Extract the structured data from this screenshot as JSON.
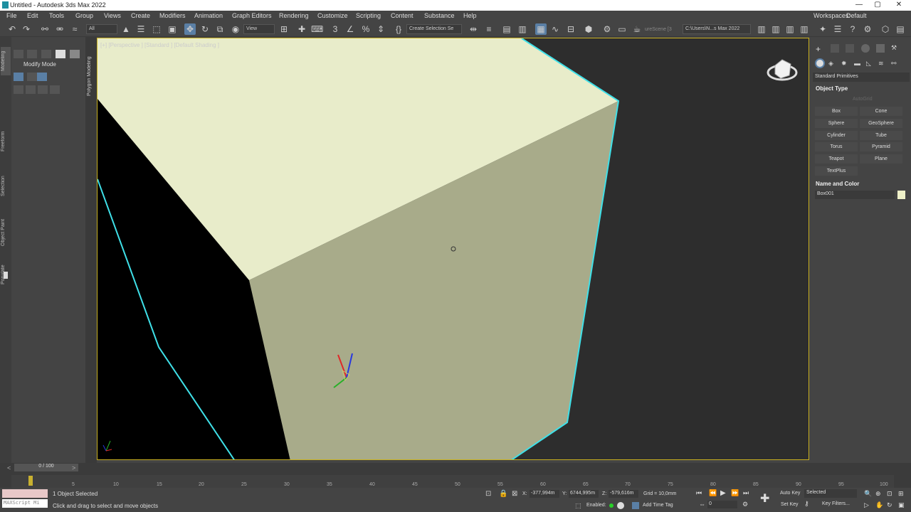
{
  "title": "Untitled - Autodesk 3ds Max 2022",
  "window": {
    "min": "—",
    "max": "▢",
    "close": "✕"
  },
  "menu": [
    {
      "label": "File"
    },
    {
      "label": "Edit"
    },
    {
      "label": "Tools"
    },
    {
      "label": "Group"
    },
    {
      "label": "Views"
    },
    {
      "label": "Create"
    },
    {
      "label": "Modifiers"
    },
    {
      "label": "Animation"
    },
    {
      "label": "Graph Editors"
    },
    {
      "label": "Rendering"
    },
    {
      "label": "Customize"
    },
    {
      "label": "Scripting"
    },
    {
      "label": "Content"
    },
    {
      "label": "Substance"
    },
    {
      "label": "Help"
    }
  ],
  "workspaces": {
    "label": "Workspaces:",
    "value": "Default"
  },
  "toolbar": {
    "filter": "All",
    "ref_coord": "View",
    "selection_set": "Create Selection Se",
    "scene_name": "ureScene [3",
    "path": "C:\\Users\\N...s Max 2022"
  },
  "left_tabs": [
    "Modeling",
    "Freeform",
    "Selection",
    "Object Paint",
    "Populate"
  ],
  "ribbon": {
    "mode": "Modify Mode",
    "side_tab": "Polygon Modeling"
  },
  "viewport": {
    "label": "[+] [Perspective ] [Standard ] [Default Shading ]",
    "colors": {
      "box_top": "#e8ecca",
      "box_front": "#a8ab8a",
      "bg": "#2d2d2d",
      "wire": "#3fe0e8"
    }
  },
  "cmd_panel": {
    "category": "Standard Primitives",
    "object_type_title": "Object Type",
    "autogrid": "AutoGrid",
    "buttons": [
      {
        "label": "Box"
      },
      {
        "label": "Cone"
      },
      {
        "label": "Sphere"
      },
      {
        "label": "GeoSphere"
      },
      {
        "label": "Cylinder"
      },
      {
        "label": "Tube"
      },
      {
        "label": "Torus"
      },
      {
        "label": "Pyramid"
      },
      {
        "label": "Teapot"
      },
      {
        "label": "Plane"
      },
      {
        "label": "TextPlus"
      }
    ],
    "name_color_title": "Name and Color",
    "object_name": "Box001",
    "object_color": "#eef0c8"
  },
  "timeline": {
    "frame": "0 / 100",
    "ticks": [
      "5",
      "10",
      "15",
      "20",
      "25",
      "30",
      "35",
      "40",
      "45",
      "50",
      "55",
      "60",
      "65",
      "70",
      "75",
      "80",
      "85",
      "90",
      "95",
      "100"
    ]
  },
  "status": {
    "maxscript": "MAXScript Mi",
    "selected": "1 Object Selected",
    "prompt": "Click and drag to select and move objects",
    "x_label": "X:",
    "x": "-377,994m",
    "y_label": "Y:",
    "y": "6744,995m",
    "z_label": "Z:",
    "z": "-579,616m",
    "grid": "Grid = 10,0mm",
    "enabled": "Enabled:",
    "add_time_tag": "Add Time Tag",
    "auto_key": "Auto Key",
    "set_key": "Set Key",
    "key_mode": "Selected",
    "key_filters": "Key Filters...",
    "frame_field": "0"
  }
}
